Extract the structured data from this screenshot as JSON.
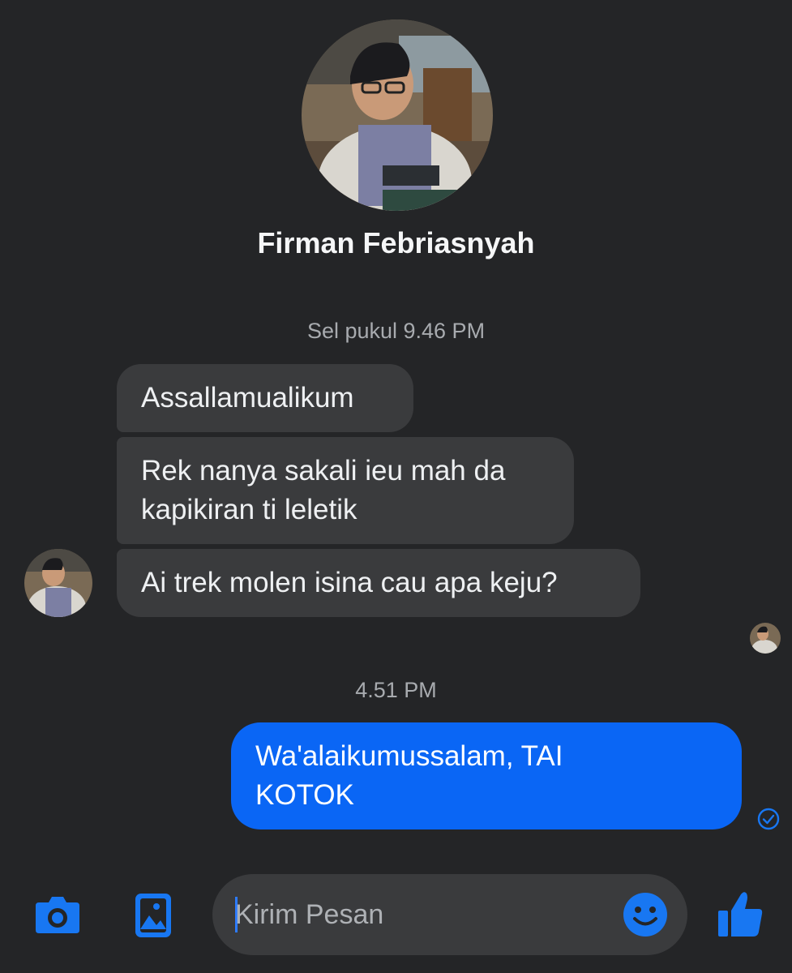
{
  "profile": {
    "name": "Firman Febriasnyah"
  },
  "messages": [
    {
      "type": "timestamp",
      "text": "Sel pukul 9.46 PM"
    },
    {
      "type": "incoming",
      "text": "Assallamualikum"
    },
    {
      "type": "incoming",
      "lines": [
        "Rek nanya sakali ieu mah da",
        "kapikiran ti leletik"
      ]
    },
    {
      "type": "incoming",
      "text": "Ai trek molen isina cau apa keju?"
    },
    {
      "type": "timestamp",
      "text": "4.51 PM"
    },
    {
      "type": "outgoing",
      "lines": [
        "Wa'alaikumussalam, TAI",
        "KOTOK"
      ]
    }
  ],
  "composer": {
    "placeholder": "Kirim Pesan",
    "icons": [
      "camera-icon",
      "image-icon",
      "emoji-icon",
      "thumbs-up-icon"
    ]
  },
  "colors": {
    "background": "#242527",
    "incoming_bubble": "#3a3b3d",
    "outgoing_bubble": "#0a66f5",
    "accent": "#1877f2"
  }
}
